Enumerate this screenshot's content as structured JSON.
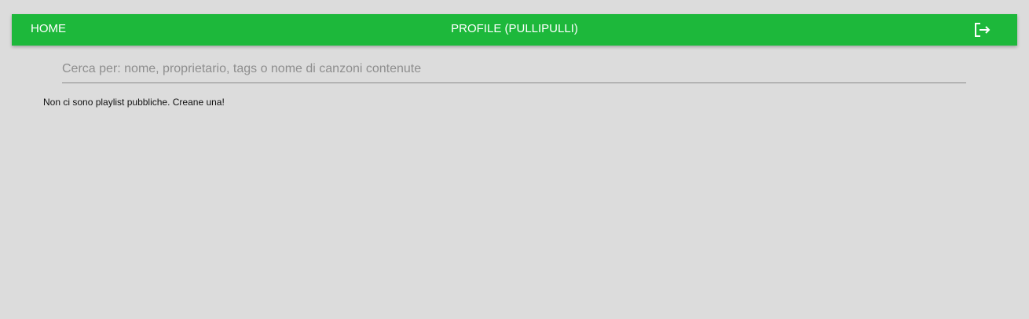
{
  "nav": {
    "home_label": "HOME",
    "profile_label": "PROFILE (PULLIPULLI)",
    "logout_icon": "logout-icon",
    "bar_color": "#1db83b"
  },
  "search": {
    "value": "",
    "placeholder": "Cerca per: nome, proprietario, tags o nome di canzoni contenute"
  },
  "content": {
    "empty_message": "Non ci sono playlist pubbliche. Creane una!"
  }
}
